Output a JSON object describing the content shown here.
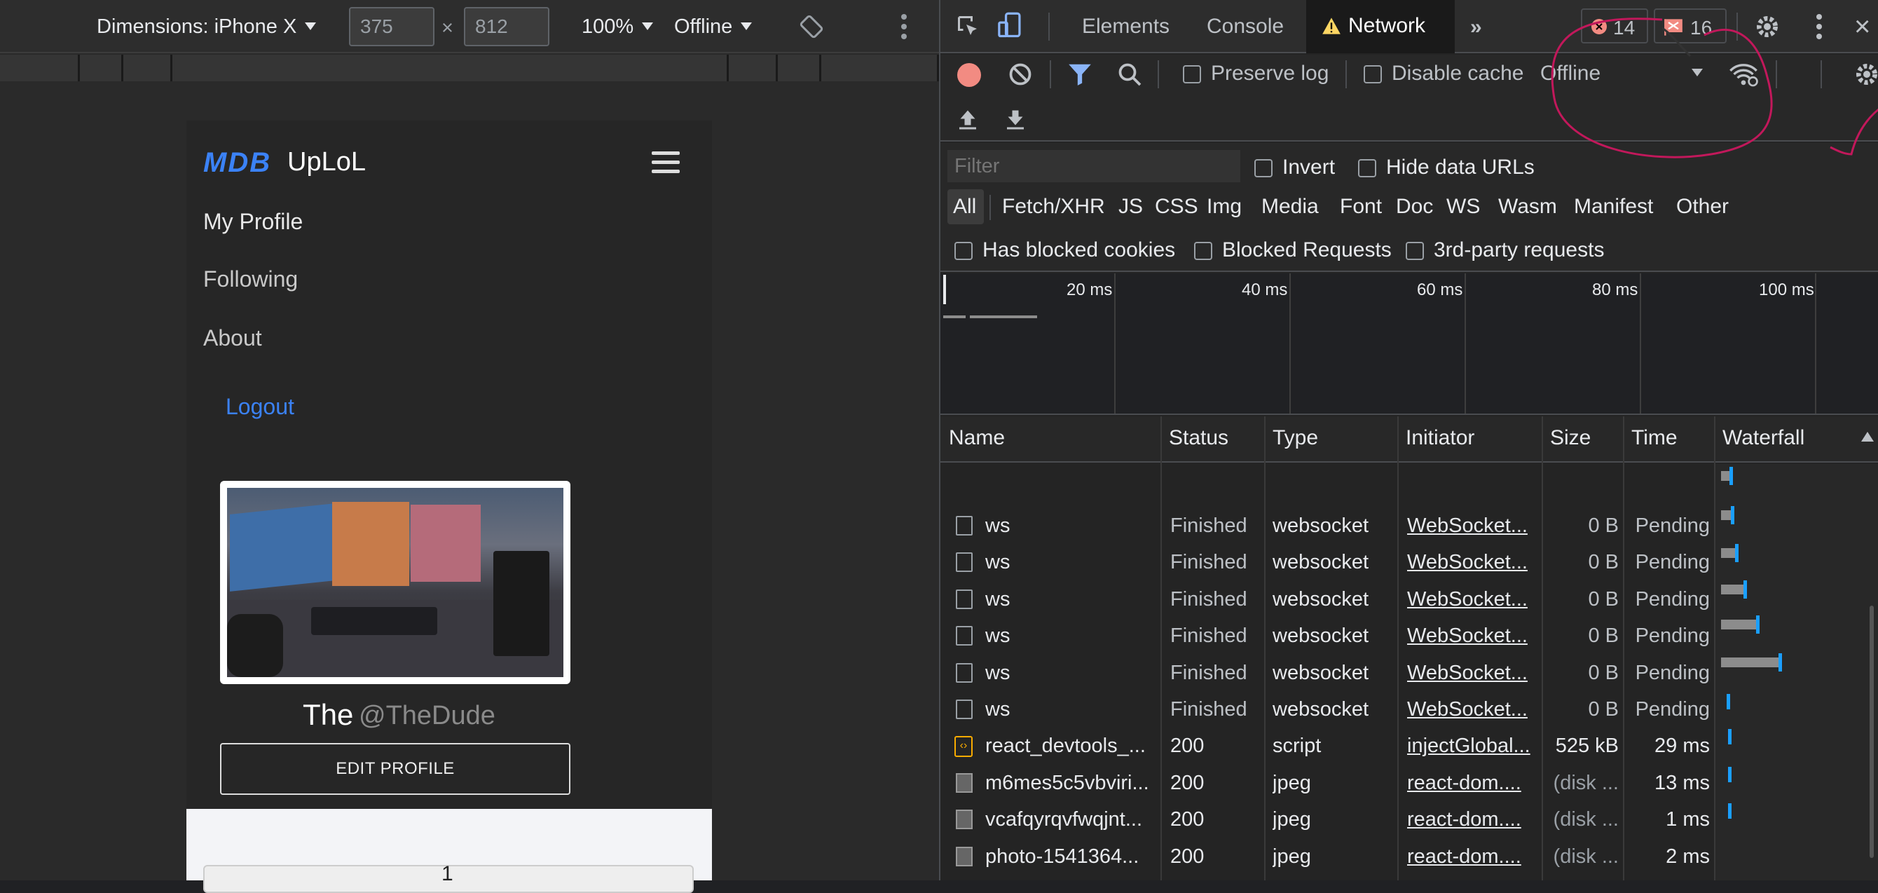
{
  "device_toolbar": {
    "dimensions_label": "Dimensions: iPhone X",
    "width": "375",
    "times": "×",
    "height": "812",
    "zoom": "100%",
    "throttle": "Offline"
  },
  "mobile": {
    "brand_logo": "MDB",
    "brand_name": "UpLoL",
    "nav": [
      "My Profile",
      "Following",
      "About"
    ],
    "logout": "Logout",
    "profile_name": "The",
    "profile_handle": "@TheDude",
    "edit_button": "EDIT PROFILE",
    "bottom_number": "1"
  },
  "devtools": {
    "tabs": [
      "Elements",
      "Console",
      "Network"
    ],
    "errors": "14",
    "warnings": "16",
    "preserve_log": "Preserve log",
    "disable_cache": "Disable cache",
    "throttle": "Offline",
    "filter_placeholder": "Filter",
    "invert": "Invert",
    "hide_data_urls": "Hide data URLs",
    "types": [
      "All",
      "Fetch/XHR",
      "JS",
      "CSS",
      "Img",
      "Media",
      "Font",
      "Doc",
      "WS",
      "Wasm",
      "Manifest",
      "Other"
    ],
    "has_blocked_cookies": "Has blocked cookies",
    "blocked_requests": "Blocked Requests",
    "third_party": "3rd-party requests",
    "timeline": [
      "20 ms",
      "40 ms",
      "60 ms",
      "80 ms",
      "100 ms"
    ],
    "columns": [
      "Name",
      "Status",
      "Type",
      "Initiator",
      "Size",
      "Time",
      "Waterfall"
    ],
    "rows": [
      {
        "name": "ws",
        "status": "Finished",
        "type": "websocket",
        "initiator": "WebSocket...",
        "size": "0 B",
        "time": "Pending"
      },
      {
        "name": "ws",
        "status": "Finished",
        "type": "websocket",
        "initiator": "WebSocket...",
        "size": "0 B",
        "time": "Pending"
      },
      {
        "name": "ws",
        "status": "Finished",
        "type": "websocket",
        "initiator": "WebSocket...",
        "size": "0 B",
        "time": "Pending"
      },
      {
        "name": "ws",
        "status": "Finished",
        "type": "websocket",
        "initiator": "WebSocket...",
        "size": "0 B",
        "time": "Pending"
      },
      {
        "name": "ws",
        "status": "Finished",
        "type": "websocket",
        "initiator": "WebSocket...",
        "size": "0 B",
        "time": "Pending"
      },
      {
        "name": "ws",
        "status": "Finished",
        "type": "websocket",
        "initiator": "WebSocket...",
        "size": "0 B",
        "time": "Pending"
      },
      {
        "name": "react_devtools_...",
        "status": "200",
        "type": "script",
        "initiator": "injectGlobal...",
        "size": "525 kB",
        "time": "29 ms"
      },
      {
        "name": "m6mes5c5vbviri...",
        "status": "200",
        "type": "jpeg",
        "initiator": "react-dom....",
        "size": "(disk ...",
        "time": "13 ms"
      },
      {
        "name": "vcafqyrqvfwqjnt...",
        "status": "200",
        "type": "jpeg",
        "initiator": "react-dom....",
        "size": "(disk ...",
        "time": "1 ms"
      },
      {
        "name": "photo-1541364...",
        "status": "200",
        "type": "jpeg",
        "initiator": "react-dom....",
        "size": "(disk ...",
        "time": "2 ms"
      }
    ],
    "colors": {
      "accent": "#8ab4f8",
      "error": "#f28b82",
      "record": "#f28b82",
      "annotation": "#c2185b"
    }
  }
}
